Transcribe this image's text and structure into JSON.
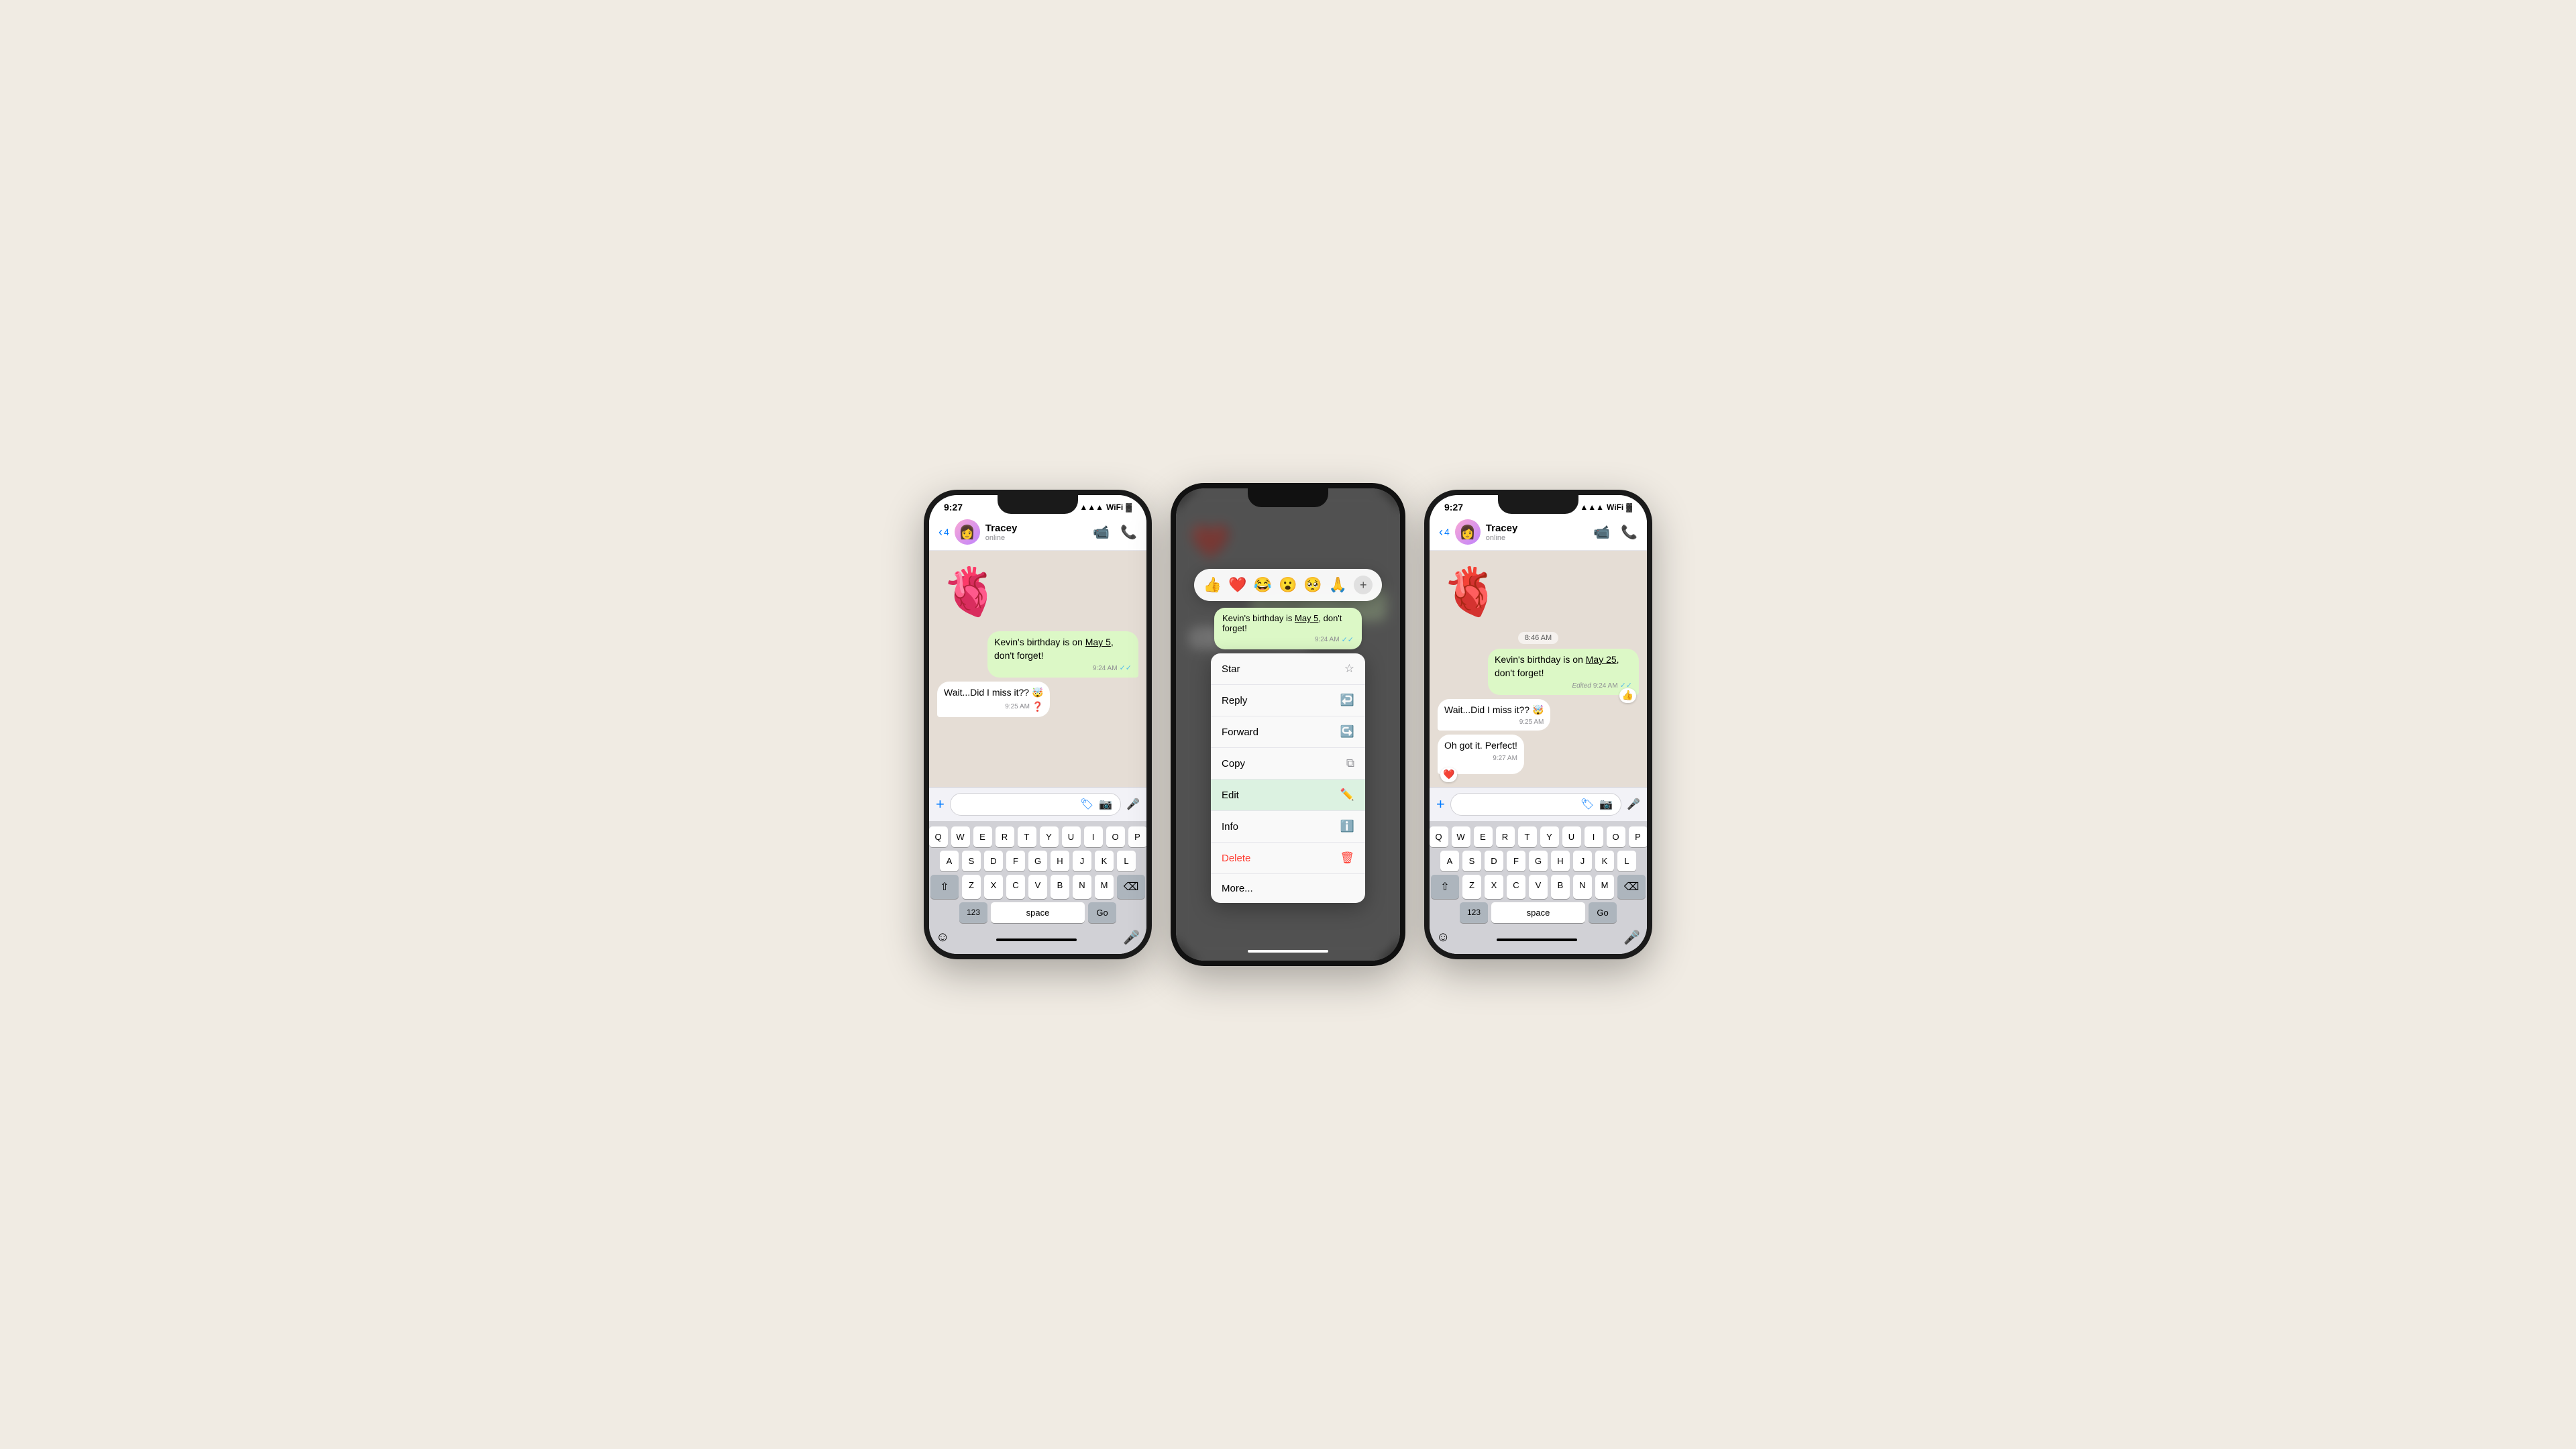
{
  "bg_color": "#f0ebe3",
  "phones": {
    "left": {
      "time": "9:27",
      "contact": {
        "name": "Tracey",
        "status": "online",
        "back_count": "4"
      },
      "messages": [
        {
          "type": "sticker",
          "direction": "received",
          "emoji": "❤️"
        },
        {
          "id": "msg1",
          "type": "text",
          "direction": "sent",
          "text": "Kevin's birthday is  on ",
          "underlined": "May 5",
          "text_after": ", don't forget!",
          "time": "9:24 AM",
          "ticks": "✓✓"
        },
        {
          "id": "msg2",
          "type": "text",
          "direction": "received",
          "text": "Wait...Did I miss it?? 🤯",
          "time": "9:25 AM"
        }
      ],
      "input_placeholder": ""
    },
    "center": {
      "time": "9:27",
      "context_message": {
        "text": "Kevin's birthday is ",
        "underlined": "May 5",
        "text_after": ", don't forget!",
        "time": "9:24 AM",
        "ticks": "✓✓"
      },
      "emoji_reactions": [
        "👍",
        "❤️",
        "😂",
        "😮",
        "🥺",
        "🙏"
      ],
      "menu_items": [
        {
          "label": "Star",
          "icon": "☆"
        },
        {
          "label": "Reply",
          "icon": "↩"
        },
        {
          "label": "Forward",
          "icon": "↪"
        },
        {
          "label": "Copy",
          "icon": "⧉"
        },
        {
          "label": "Edit",
          "icon": "✏️",
          "highlighted": true
        },
        {
          "label": "Info",
          "icon": "ℹ"
        },
        {
          "label": "Delete",
          "icon": "🗑",
          "danger": true
        },
        {
          "label": "More...",
          "icon": ""
        }
      ]
    },
    "right": {
      "time": "9:27",
      "contact": {
        "name": "Tracey",
        "status": "online",
        "back_count": "4"
      },
      "messages": [
        {
          "type": "sticker",
          "direction": "received"
        },
        {
          "id": "msg1",
          "type": "text",
          "direction": "sent",
          "text": "Kevin's birthday is  on ",
          "underlined": "May 25",
          "text_after": ", don't forget!",
          "edited_label": "Edited",
          "time": "9:24 AM",
          "ticks": "✓✓",
          "reaction": "👍"
        },
        {
          "id": "msg2",
          "type": "text",
          "direction": "received",
          "text": "Wait...Did I miss it?? 🤯",
          "time": "9:25 AM"
        },
        {
          "id": "msg3",
          "type": "text",
          "direction": "received",
          "text": "Oh got it. Perfect!",
          "time": "9:27 AM",
          "reaction": "❤️"
        }
      ]
    }
  },
  "keyboard": {
    "rows": [
      [
        "Q",
        "W",
        "E",
        "R",
        "T",
        "Y",
        "U",
        "I",
        "O",
        "P"
      ],
      [
        "A",
        "S",
        "D",
        "F",
        "G",
        "H",
        "J",
        "K",
        "L"
      ],
      [
        "Z",
        "X",
        "C",
        "V",
        "B",
        "N",
        "M"
      ]
    ],
    "space_label": "space",
    "go_label": "Go",
    "num_label": "123"
  }
}
